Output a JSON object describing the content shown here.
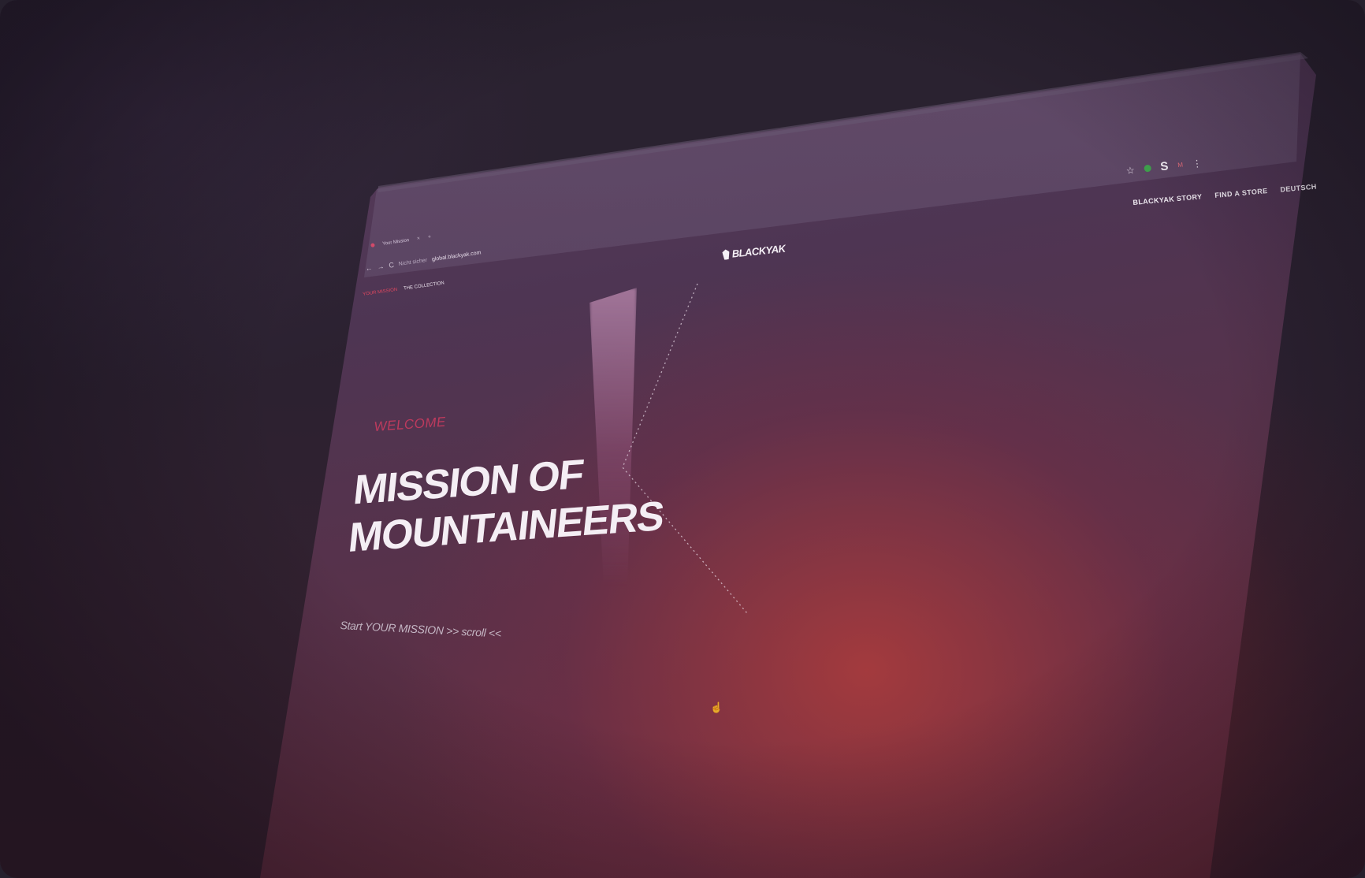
{
  "browser": {
    "tab_title": "Your Mission",
    "tab_close": "×",
    "new_tab": "+",
    "nav_back": "←",
    "nav_forward": "→",
    "nav_reload": "C",
    "security_label": "Nicht sicher",
    "url": "global.blackyak.com",
    "toolbar": {
      "bookmark_star": "☆",
      "extension_s": "S",
      "menu_dots": "⋮",
      "profile_m": "M"
    }
  },
  "site": {
    "logo_text": "BLACKYAK",
    "nav": [
      "BLACKYAK STORY",
      "FIND A STORE",
      "DEUTSCH"
    ],
    "subnav": {
      "active": "YOUR MISSION",
      "other": "THE COLLECTION"
    },
    "hero": {
      "welcome": "WELCOME",
      "headline_line1": "MISSION OF",
      "headline_line2": "MOUNTAINEERS",
      "cta": "Start YOUR MISSION >> scroll <<"
    }
  },
  "colors": {
    "accent": "#d03c60",
    "headline": "#f4eef4"
  }
}
